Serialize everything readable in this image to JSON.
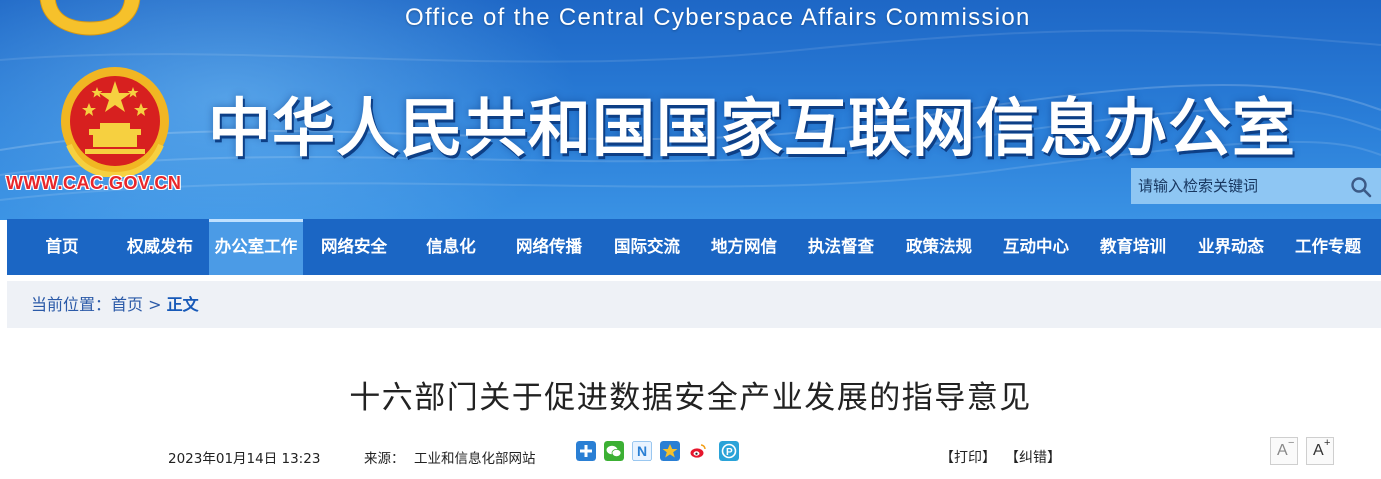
{
  "header": {
    "english_title": "Office of the Central Cyberspace Affairs Commission",
    "chinese_title": "中华人民共和国国家互联网信息办公室",
    "site_url": "WWW.CAC.GOV.CN",
    "search_placeholder": "请输入检索关键词"
  },
  "nav": {
    "items": [
      {
        "label": "首页"
      },
      {
        "label": "权威发布"
      },
      {
        "label": "办公室工作",
        "active": true
      },
      {
        "label": "网络安全"
      },
      {
        "label": "信息化"
      },
      {
        "label": "网络传播"
      },
      {
        "label": "国际交流"
      },
      {
        "label": "地方网信"
      },
      {
        "label": "执法督查"
      },
      {
        "label": "政策法规"
      },
      {
        "label": "互动中心"
      },
      {
        "label": "教育培训"
      },
      {
        "label": "业界动态"
      },
      {
        "label": "工作专题"
      }
    ]
  },
  "breadcrumb": {
    "prefix": "当前位置：",
    "home": "首页",
    "separator": ">",
    "current": "正文"
  },
  "article": {
    "title": "十六部门关于促进数据安全产业发展的指导意见",
    "datetime": "2023年01月14日 13:23",
    "source_label": "来源：",
    "source": "工业和信息化部网站",
    "print_label": "【打印】",
    "correct_label": "【纠错】",
    "font_smaller": "A",
    "font_larger": "A"
  },
  "share_icons": [
    "share-plus-icon",
    "wechat-icon",
    "n-icon",
    "qzone-icon",
    "weibo-icon",
    "p-icon"
  ],
  "colors": {
    "banner": "#2a7ed8",
    "nav": "#1b66c4",
    "nav_active": "#4b9be6",
    "url_red": "#e8262a",
    "crumb_bg": "#eef1f6",
    "crumb_text": "#2b5aa8"
  }
}
